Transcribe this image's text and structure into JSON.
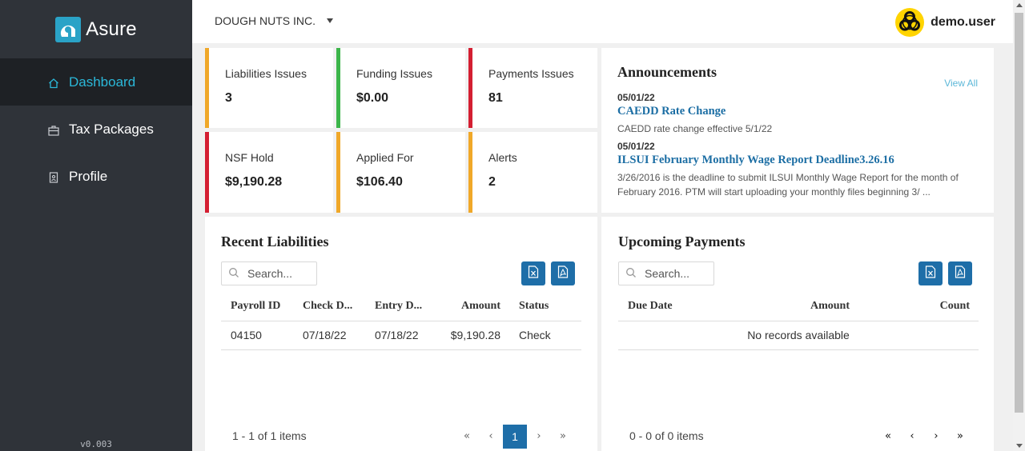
{
  "brand": {
    "name": "Asure"
  },
  "sidebar": {
    "items": [
      {
        "label": "Dashboard",
        "icon": "home-icon"
      },
      {
        "label": "Tax Packages",
        "icon": "briefcase-icon"
      },
      {
        "label": "Profile",
        "icon": "id-badge-icon"
      }
    ],
    "version": "v0.003"
  },
  "topbar": {
    "company": "DOUGH NUTS INC.",
    "username": "demo.user"
  },
  "tiles": [
    {
      "label": "Liabilities Issues",
      "value": "3",
      "color": "#f0a829"
    },
    {
      "label": "Funding Issues",
      "value": "$0.00",
      "color": "#3cb54a"
    },
    {
      "label": "Payments Issues",
      "value": "81",
      "color": "#d41f32"
    },
    {
      "label": "NSF Hold",
      "value": "$9,190.28",
      "color": "#d41f32"
    },
    {
      "label": "Applied For",
      "value": "$106.40",
      "color": "#f0a829"
    },
    {
      "label": "Alerts",
      "value": "2",
      "color": "#f0a829"
    }
  ],
  "announcements": {
    "title": "Announcements",
    "view_all": "View All",
    "items": [
      {
        "date": "05/01/22",
        "title": "CAEDD Rate Change",
        "body": "CAEDD rate change effective 5/1/22"
      },
      {
        "date": "05/01/22",
        "title": "ILSUI February Monthly Wage Report Deadline3.26.16",
        "body": "3/26/2016 is the deadline to submit ILSUI Monthly Wage Report for the month of February 2016. PTM will start uploading your monthly files beginning 3/ ..."
      }
    ]
  },
  "recent_liabilities": {
    "title": "Recent Liabilities",
    "search_placeholder": "Search...",
    "columns": [
      "Payroll ID",
      "Check D...",
      "Entry D...",
      "Amount",
      "Status"
    ],
    "rows": [
      [
        "04150",
        "07/18/22",
        "07/18/22",
        "$9,190.28",
        "Check"
      ]
    ],
    "pager_info": "1 - 1 of 1 items",
    "current_page": "1"
  },
  "upcoming_payments": {
    "title": "Upcoming Payments",
    "search_placeholder": "Search...",
    "columns": [
      "Due Date",
      "Amount",
      "Count"
    ],
    "empty_text": "No records available",
    "pager_info": "0 - 0 of 0 items"
  },
  "colors": {
    "accent": "#2bb8d9",
    "primary": "#1e6ea8",
    "sidebar": "#2f3339"
  }
}
